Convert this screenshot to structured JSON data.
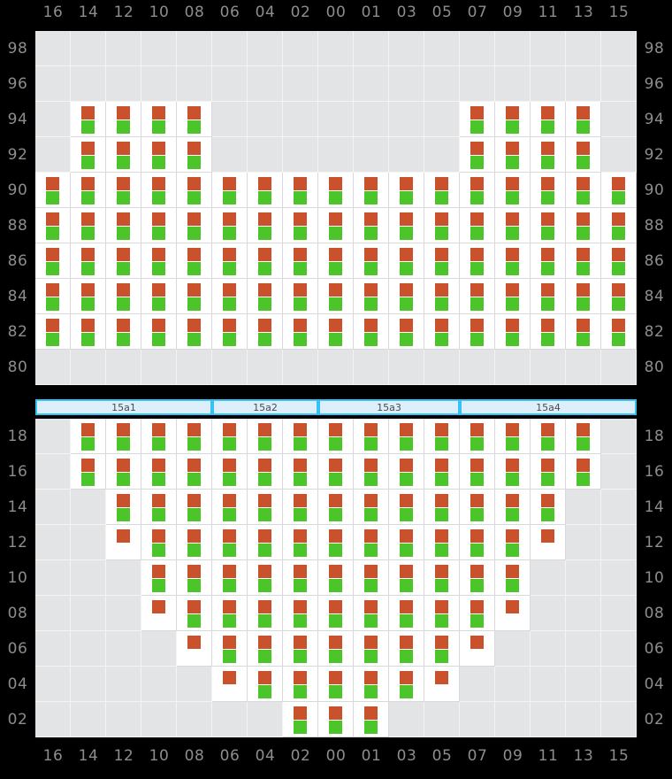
{
  "meta": {
    "background_color": "#000000",
    "cell_on_color": "#ffffff",
    "cell_off_color": "#e3e4e6",
    "marker_red": "#c9512b",
    "marker_green": "#4cc52a",
    "band_fill": "#ddeffb",
    "band_border": "#35c3f5",
    "label_color": "#8b8d90"
  },
  "axes": {
    "columns": [
      "16",
      "14",
      "12",
      "10",
      "08",
      "06",
      "04",
      "02",
      "00",
      "01",
      "03",
      "05",
      "07",
      "09",
      "11",
      "13",
      "15"
    ],
    "top_rows": [
      "98",
      "96",
      "94",
      "92",
      "90",
      "88",
      "86",
      "84",
      "82",
      "80"
    ],
    "bottom_rows": [
      "18",
      "16",
      "14",
      "12",
      "10",
      "08",
      "06",
      "04",
      "02"
    ]
  },
  "group_band": {
    "segments": [
      {
        "label": "15a1",
        "span": 5
      },
      {
        "label": "15a2",
        "span": 3
      },
      {
        "label": "15a3",
        "span": 4
      },
      {
        "label": "15a4",
        "span": 5
      }
    ]
  },
  "chart_data": {
    "type": "heatmap",
    "title": "",
    "xlabel": "",
    "ylabel": "",
    "legend": [
      {
        "name": "red-marker",
        "color": "#c9512b"
      },
      {
        "name": "green-marker",
        "color": "#4cc52a"
      }
    ],
    "x": [
      "16",
      "14",
      "12",
      "10",
      "08",
      "06",
      "04",
      "02",
      "00",
      "01",
      "03",
      "05",
      "07",
      "09",
      "11",
      "13",
      "15"
    ],
    "panels": [
      {
        "name": "top-panel",
        "y": [
          "98",
          "96",
          "94",
          "92",
          "90",
          "88",
          "86",
          "84",
          "82",
          "80"
        ],
        "cells": [
          [
            "",
            "",
            "",
            "",
            "",
            "",
            "",
            "",
            "",
            "",
            "",
            "",
            "",
            "",
            "",
            "",
            ""
          ],
          [
            "",
            "",
            "",
            "",
            "",
            "",
            "",
            "",
            "",
            "",
            "",
            "",
            "",
            "",
            "",
            "",
            ""
          ],
          [
            "",
            "rg",
            "rg",
            "rg",
            "rg",
            "",
            "",
            "",
            "",
            "",
            "",
            "",
            "rg",
            "rg",
            "rg",
            "rg",
            ""
          ],
          [
            "",
            "rg",
            "rg",
            "rg",
            "rg",
            "",
            "",
            "",
            "",
            "",
            "",
            "",
            "rg",
            "rg",
            "rg",
            "rg",
            ""
          ],
          [
            "rg",
            "rg",
            "rg",
            "rg",
            "rg",
            "rg",
            "rg",
            "rg",
            "rg",
            "rg",
            "rg",
            "rg",
            "rg",
            "rg",
            "rg",
            "rg",
            "rg"
          ],
          [
            "rg",
            "rg",
            "rg",
            "rg",
            "rg",
            "rg",
            "rg",
            "rg",
            "rg",
            "rg",
            "rg",
            "rg",
            "rg",
            "rg",
            "rg",
            "rg",
            "rg"
          ],
          [
            "rg",
            "rg",
            "rg",
            "rg",
            "rg",
            "rg",
            "rg",
            "rg",
            "rg",
            "rg",
            "rg",
            "rg",
            "rg",
            "rg",
            "rg",
            "rg",
            "rg"
          ],
          [
            "rg",
            "rg",
            "rg",
            "rg",
            "rg",
            "rg",
            "rg",
            "rg",
            "rg",
            "rg",
            "rg",
            "rg",
            "rg",
            "rg",
            "rg",
            "rg",
            "rg"
          ],
          [
            "rg",
            "rg",
            "rg",
            "rg",
            "rg",
            "rg",
            "rg",
            "rg",
            "rg",
            "rg",
            "rg",
            "rg",
            "rg",
            "rg",
            "rg",
            "rg",
            "rg"
          ],
          [
            "",
            "",
            "",
            "",
            "",
            "",
            "",
            "",
            "",
            "",
            "",
            "",
            "",
            "",
            "",
            "",
            ""
          ]
        ]
      },
      {
        "name": "bottom-panel",
        "y": [
          "18",
          "16",
          "14",
          "12",
          "10",
          "08",
          "06",
          "04",
          "02"
        ],
        "cells": [
          [
            "",
            "rg",
            "rg",
            "rg",
            "rg",
            "rg",
            "rg",
            "rg",
            "rg",
            "rg",
            "rg",
            "rg",
            "rg",
            "rg",
            "rg",
            "rg",
            ""
          ],
          [
            "",
            "rg",
            "rg",
            "rg",
            "rg",
            "rg",
            "rg",
            "rg",
            "rg",
            "rg",
            "rg",
            "rg",
            "rg",
            "rg",
            "rg",
            "rg",
            ""
          ],
          [
            "",
            "",
            "rg",
            "rg",
            "rg",
            "rg",
            "rg",
            "rg",
            "rg",
            "rg",
            "rg",
            "rg",
            "rg",
            "rg",
            "rg",
            "",
            ""
          ],
          [
            "",
            "",
            "r",
            "rg",
            "rg",
            "rg",
            "rg",
            "rg",
            "rg",
            "rg",
            "rg",
            "rg",
            "rg",
            "rg",
            "r",
            "",
            ""
          ],
          [
            "",
            "",
            "",
            "rg",
            "rg",
            "rg",
            "rg",
            "rg",
            "rg",
            "rg",
            "rg",
            "rg",
            "rg",
            "rg",
            "",
            "",
            ""
          ],
          [
            "",
            "",
            "",
            "r",
            "rg",
            "rg",
            "rg",
            "rg",
            "rg",
            "rg",
            "rg",
            "rg",
            "rg",
            "r",
            "",
            "",
            ""
          ],
          [
            "",
            "",
            "",
            "",
            "r",
            "rg",
            "rg",
            "rg",
            "rg",
            "rg",
            "rg",
            "rg",
            "r",
            "",
            "",
            "",
            ""
          ],
          [
            "",
            "",
            "",
            "",
            "",
            "r",
            "rg",
            "rg",
            "rg",
            "rg",
            "rg",
            "r",
            "",
            "",
            "",
            "",
            ""
          ],
          [
            "",
            "",
            "",
            "",
            "",
            "",
            "",
            "rg",
            "rg",
            "rg",
            "",
            "",
            "",
            "",
            "",
            "",
            ""
          ]
        ]
      }
    ]
  }
}
